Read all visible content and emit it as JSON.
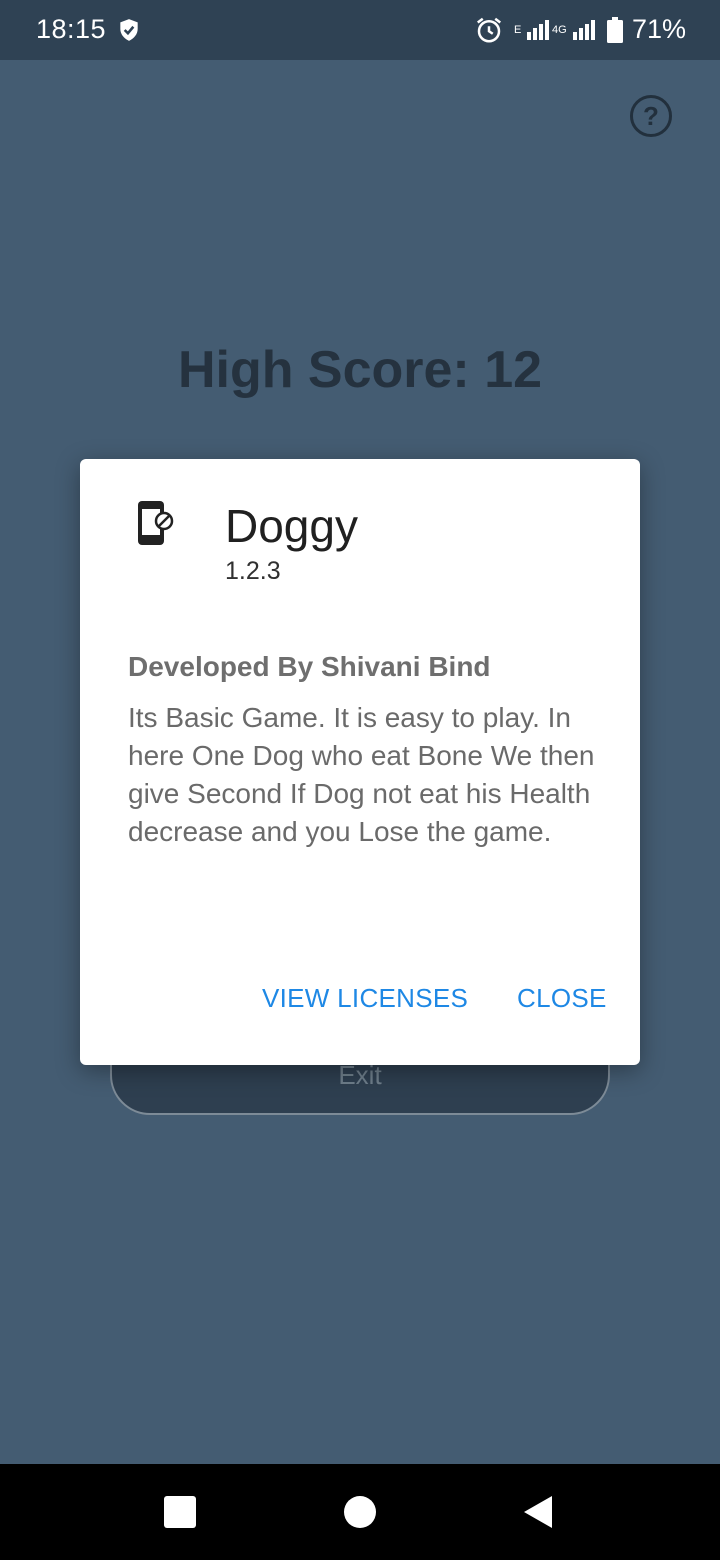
{
  "status_bar": {
    "time": "18:15",
    "network_1": "E",
    "network_2": "4G",
    "battery": "71%"
  },
  "screen": {
    "high_score_text": "High Score: 12",
    "exit_label": "Exit",
    "help_icon": "help-circle-icon"
  },
  "dialog": {
    "app_name": "Doggy",
    "version": "1.2.3",
    "developer": "Developed By Shivani Bind",
    "description": "Its Basic Game. It is easy to play. In here One Dog who eat Bone We then give Second If Dog not eat his Health decrease and you Lose the game.",
    "view_licenses": "VIEW LICENSES",
    "close": "CLOSE"
  },
  "colors": {
    "background": "#445c72",
    "status_bar": "#2f4254",
    "accent": "#1e88e5"
  }
}
